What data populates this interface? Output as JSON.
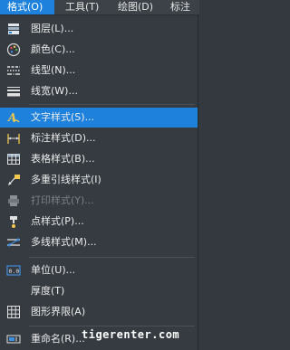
{
  "menubar": {
    "format": "格式(O)",
    "tools": "工具(T)",
    "draw": "绘图(D)",
    "dimension": "标注"
  },
  "menu": {
    "layer": "图层(L)...",
    "color": "颜色(C)...",
    "linetype": "线型(N)...",
    "lineweight": "线宽(W)...",
    "text_style": "文字样式(S)...",
    "dim_style": "标注样式(D)...",
    "table_style": "表格样式(B)...",
    "mleader_style": "多重引线样式(I)",
    "plot_style": "打印样式(Y)...",
    "point_style": "点样式(P)...",
    "mline_style": "多线样式(M)...",
    "units": "单位(U)...",
    "thickness": "厚度(T)",
    "limits": "图形界限(A)",
    "rename": "重命名(R)..."
  },
  "watermark": "tigerenter.com",
  "colors": {
    "highlight": "#1e82dc",
    "menu_bg": "#353b41",
    "text": "#ececec",
    "disabled_text": "#7b8086"
  }
}
